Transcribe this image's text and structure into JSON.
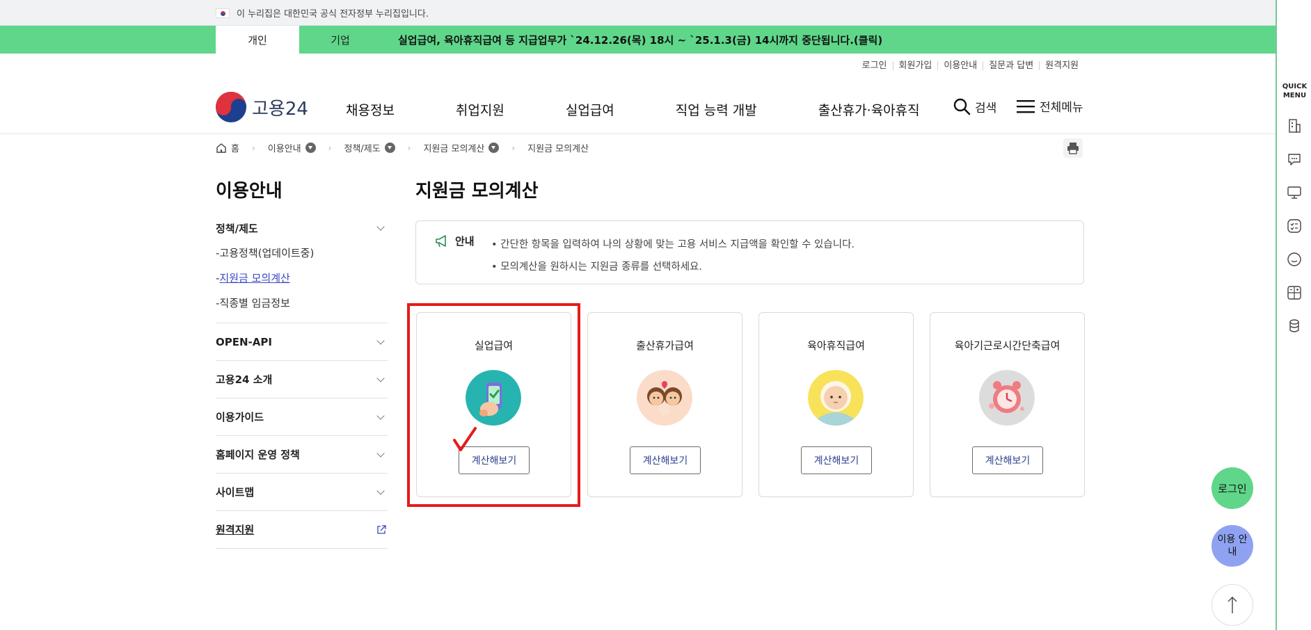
{
  "gov_banner": {
    "text": "이 누리집은 대한민국 공식 전자정부 누리집입니다."
  },
  "notice": {
    "tab_personal": "개인",
    "tab_corp": "기업",
    "message": "실업급여, 육아휴직급여 등 지급업무가 `24.12.26(목) 18시 ~ `25.1.3(금) 14시까지 중단됩니다.(클릭)"
  },
  "util_links": [
    "로그인",
    "회원가입",
    "이용안내",
    "질문과 답변",
    "원격지원"
  ],
  "header": {
    "logo_text": "고용24",
    "gnb": [
      "채용정보",
      "취업지원",
      "실업급여",
      "직업 능력 개발",
      "출산휴가·육아휴직"
    ],
    "search_label": "검색",
    "menu_label": "전체메뉴"
  },
  "breadcrumb": [
    "홈",
    "이용안내",
    "정책/제도",
    "지원금 모의계산",
    "지원금 모의계산"
  ],
  "sidebar": {
    "title": "이용안내",
    "open_group": {
      "label": "정책/제도",
      "items": [
        "고용정책(업데이트중)",
        "지원금 모의계산",
        "직종별 임금정보"
      ]
    },
    "groups": [
      "OPEN-API",
      "고용24 소개",
      "이용가이드",
      "홈페이지 운영 정책",
      "사이트맵",
      "원격지원"
    ]
  },
  "main": {
    "title": "지원금 모의계산",
    "info_label": "안내",
    "info_lines": [
      "• 간단한 항목을 입력하여 나의 상황에 맞는 고용 서비스 지급액을 확인할 수 있습니다.",
      "• 모의계산을 원하시는 지원금 종류를 선택하세요."
    ],
    "cards": [
      {
        "title": "실업급여",
        "button": "계산해보기"
      },
      {
        "title": "출산휴가급여",
        "button": "계산해보기"
      },
      {
        "title": "육아휴직급여",
        "button": "계산해보기"
      },
      {
        "title": "육아기근로시간단축급여",
        "button": "계산해보기"
      }
    ]
  },
  "quick_menu": {
    "title": "QUICK MENU"
  },
  "floating": {
    "login": "로그인",
    "guide": "이용 안내"
  },
  "colors": {
    "accent_green": "#5fd68a",
    "guide_blue": "#8fa2f2",
    "highlight_red": "#e51b1b",
    "link_blue": "#3a46c6"
  }
}
